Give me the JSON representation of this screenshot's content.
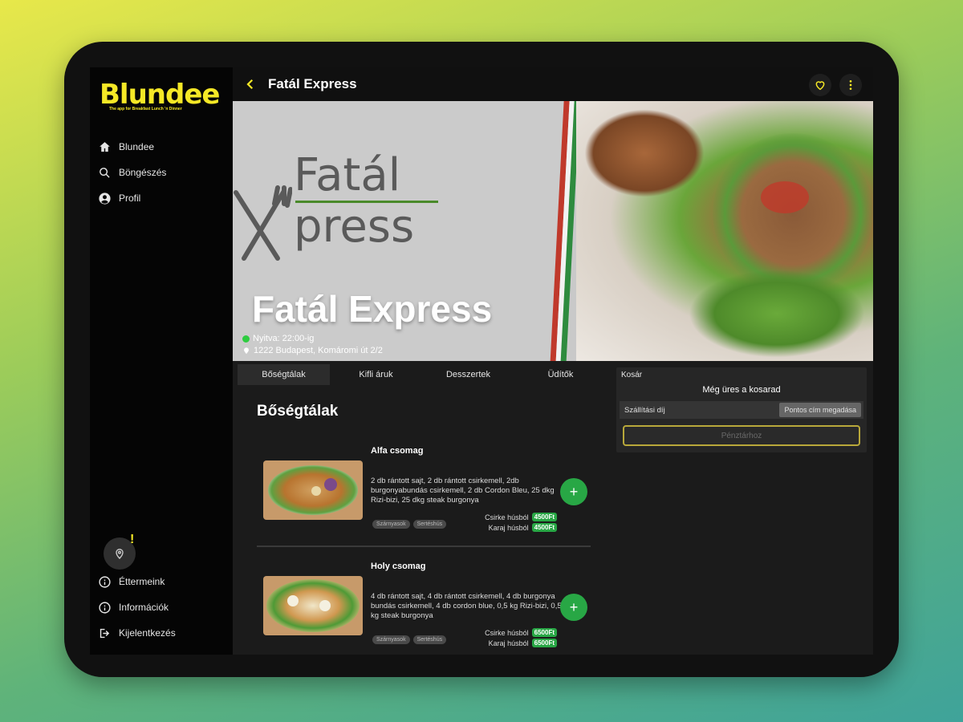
{
  "app": {
    "logo": "Blundee",
    "tagline": "The app for Breakfast Lunch 'n Dinner"
  },
  "sidebar": {
    "items_top": [
      {
        "label": "Blundee",
        "icon": "home-icon"
      },
      {
        "label": "Böngészés",
        "icon": "search-icon"
      },
      {
        "label": "Profil",
        "icon": "profile-icon"
      }
    ],
    "location_alert": "!",
    "items_bottom": [
      {
        "label": "Éttermeink",
        "icon": "info-icon"
      },
      {
        "label": "Információk",
        "icon": "info-icon"
      },
      {
        "label": "Kijelentkezés",
        "icon": "logout-icon"
      }
    ]
  },
  "header": {
    "title": "Fatál Express"
  },
  "banner": {
    "logo_top": "Fatál",
    "logo_bottom": "press",
    "name": "Fatál Express",
    "open_status": "Nyitva: 22:00-ig",
    "address": "1222 Budapest, Komáromi út 2/2"
  },
  "tabs": [
    "Bőségtálak",
    "Kifli áruk",
    "Desszertek",
    "Üdítők"
  ],
  "section": {
    "title": "Bőségtálak"
  },
  "items": [
    {
      "name": "Alfa csomag",
      "description": "2 db rántott sajt, 2 db rántott csirkemell, 2db burgonyabundás csirkemell, 2 db Cordon Bleu, 25 dkg Rizi-bizi, 25 dkg steak burgonya",
      "tags": [
        "Szárnyasok",
        "Sertéshús"
      ],
      "prices": [
        {
          "label": "Csirke húsból",
          "value": "4500Ft"
        },
        {
          "label": "Karaj húsból",
          "value": "4500Ft"
        }
      ],
      "add_label": "+"
    },
    {
      "name": "Holy csomag",
      "description": "4 db rántott sajt, 4 db rántott csirkemell, 4 db burgonya bundás csirkemell, 4 db cordon blue, 0,5 kg Rizi-bizi, 0,5 kg steak burgonya",
      "tags": [
        "Szárnyasok",
        "Sertéshús"
      ],
      "prices": [
        {
          "label": "Csirke húsból",
          "value": "6500Ft"
        },
        {
          "label": "Karaj húsból",
          "value": "6500Ft"
        }
      ],
      "add_label": "+"
    }
  ],
  "cart": {
    "title": "Kosár",
    "empty_text": "Még üres a kosarad",
    "fee_label": "Szállítási díj",
    "address_button": "Pontos cím megadása",
    "pay_button": "Pénztárhoz"
  },
  "colors": {
    "brand": "#f5e826",
    "accent": "#28a745",
    "background": "#1b1b1b"
  }
}
